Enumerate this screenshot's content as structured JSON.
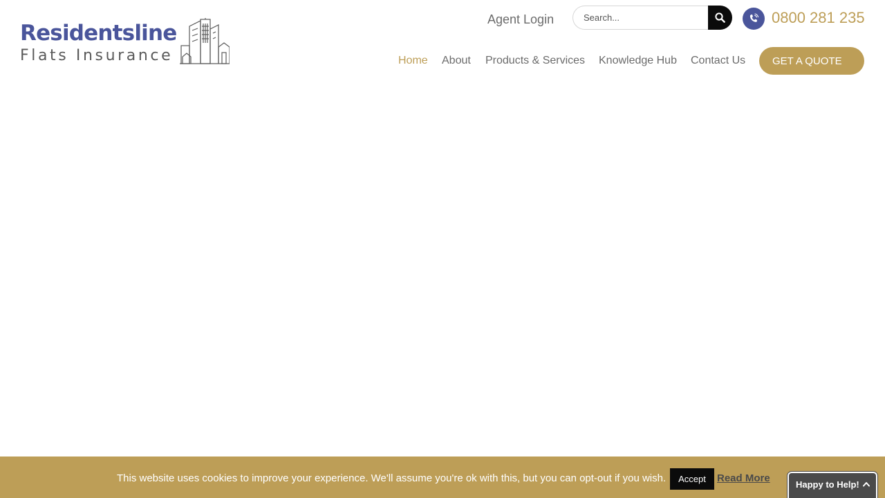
{
  "logo": {
    "line1": "Residentsline",
    "line2": "Flats Insurance",
    "icon": "city-buildings-icon"
  },
  "header": {
    "agent_login": "Agent Login",
    "search": {
      "placeholder": "Search...",
      "value": "",
      "icon": "search-icon"
    },
    "phone": {
      "icon": "phone-icon",
      "number": "0800 281 235"
    }
  },
  "nav": {
    "items": [
      {
        "label": "Home",
        "active": true
      },
      {
        "label": "About",
        "active": false
      },
      {
        "label": "Products & Services",
        "active": false
      },
      {
        "label": "Knowledge Hub",
        "active": false
      },
      {
        "label": "Contact Us",
        "active": false
      }
    ],
    "cta": "GET A QUOTE"
  },
  "cookie_bar": {
    "message": "This website uses cookies to improve your experience. We'll assume you're ok with this, but you can opt-out if you wish.",
    "accept": "Accept",
    "read_more": "Read More"
  },
  "help_widget": {
    "label": "Happy to Help!",
    "icon": "chevron-up-icon"
  },
  "colors": {
    "brand_blue": "#4a559b",
    "brand_gold": "#bd9e57",
    "text_grey": "#6b6b6b",
    "dark": "#0b0b0b",
    "widget_grey": "#4a4a4a"
  }
}
